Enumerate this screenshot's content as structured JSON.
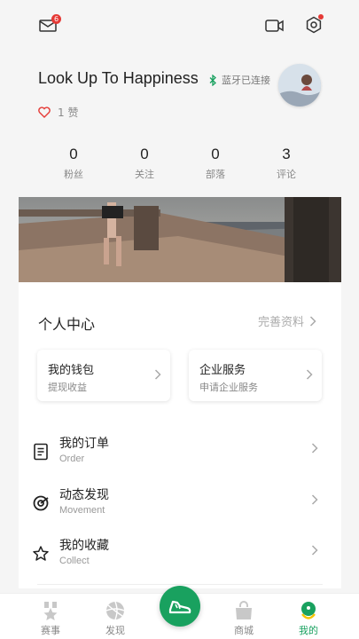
{
  "header": {
    "mail_badge": "6"
  },
  "profile": {
    "username": "Look Up To Happiness",
    "bluetooth_status": "蓝牙已连接",
    "likes": "1 赞"
  },
  "stats": [
    {
      "value": "0",
      "label": "粉丝"
    },
    {
      "value": "0",
      "label": "关注"
    },
    {
      "value": "0",
      "label": "部落"
    },
    {
      "value": "3",
      "label": "评论"
    }
  ],
  "personal_center": {
    "title": "个人中心",
    "complete_profile": "完善资料",
    "wallet": {
      "title": "我的钱包",
      "subtitle": "提现收益"
    },
    "enterprise": {
      "title": "企业服务",
      "subtitle": "申请企业服务"
    }
  },
  "menu": [
    {
      "title": "我的订单",
      "subtitle": "Order",
      "icon": "order-icon"
    },
    {
      "title": "动态发现",
      "subtitle": "Movement",
      "icon": "discover-icon"
    },
    {
      "title": "我的收藏",
      "subtitle": "Collect",
      "icon": "star-icon"
    }
  ],
  "tabs": [
    {
      "label": "赛事",
      "icon": "medal-icon"
    },
    {
      "label": "发现",
      "icon": "compass-icon"
    },
    {
      "label": "",
      "icon": "run-shoe-icon"
    },
    {
      "label": "商城",
      "icon": "shop-bag-icon"
    },
    {
      "label": "我的",
      "icon": "profile-icon"
    }
  ],
  "colors": {
    "accent": "#19a15f",
    "badge": "#e53935"
  }
}
